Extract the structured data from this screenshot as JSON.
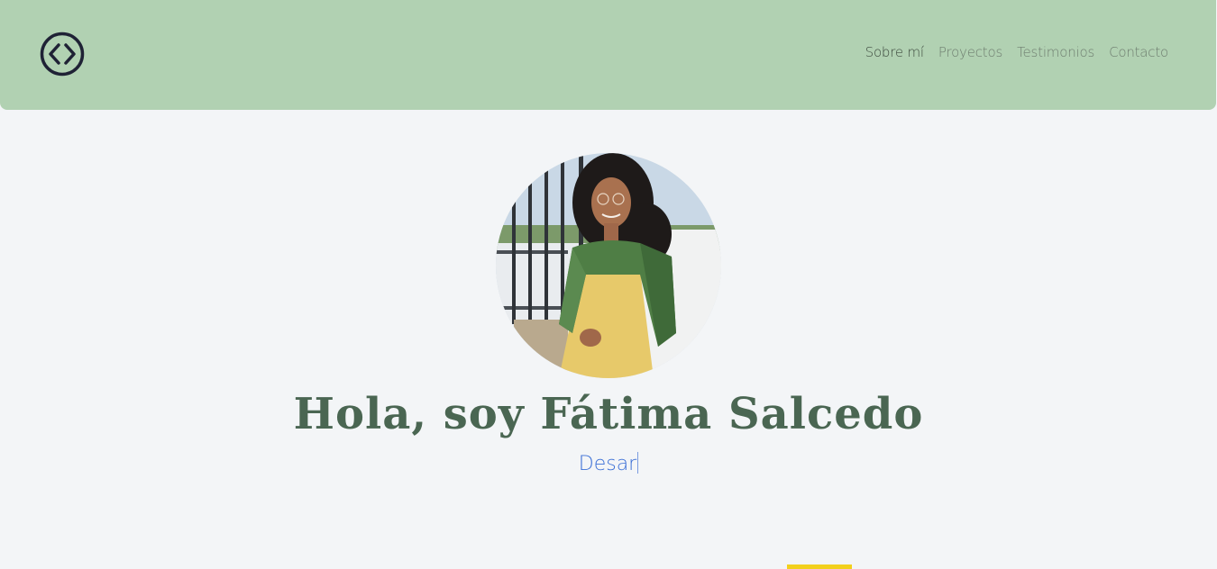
{
  "header": {
    "logo_icon": "code-brackets-circle-icon",
    "bg_color": "#b1d1b2"
  },
  "nav": {
    "items": [
      {
        "label": "Sobre mí",
        "active": true
      },
      {
        "label": "Proyectos",
        "active": false
      },
      {
        "label": "Testimonios",
        "active": false
      },
      {
        "label": "Contacto",
        "active": false
      }
    ]
  },
  "hero": {
    "title": "Hola, soy Fátima Salcedo",
    "typed_text": "Desar",
    "title_color": "#4a6652",
    "typed_color": "#3b6fd6"
  },
  "accent": {
    "yellow": "#f2d01c"
  }
}
